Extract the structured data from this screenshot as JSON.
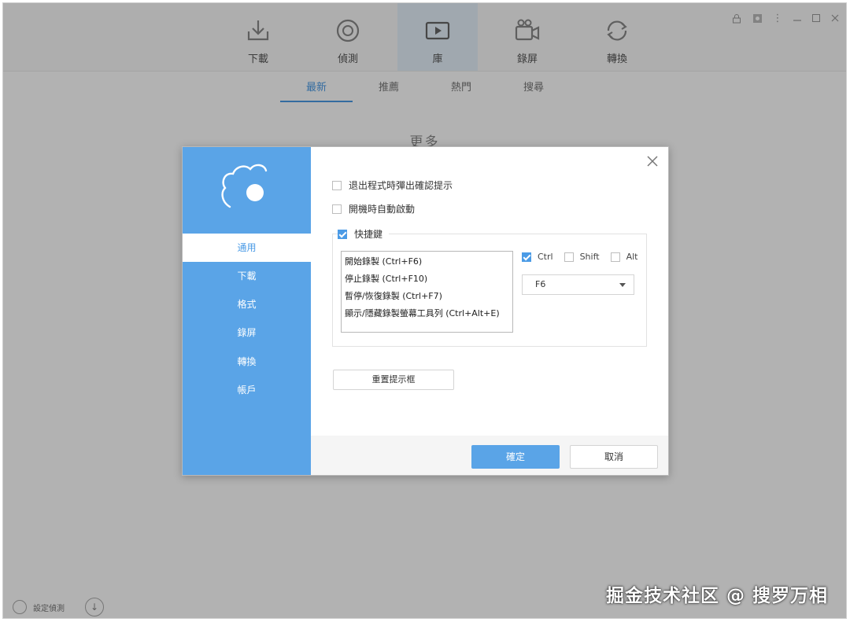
{
  "app": {
    "nav": [
      {
        "label": "下載",
        "icon": "download-icon",
        "active": false
      },
      {
        "label": "偵測",
        "icon": "detect-icon",
        "active": false
      },
      {
        "label": "庫",
        "icon": "library-icon",
        "active": true
      },
      {
        "label": "錄屏",
        "icon": "screen-record-icon",
        "active": false
      },
      {
        "label": "轉換",
        "icon": "convert-icon",
        "active": false
      }
    ],
    "subtabs": [
      "最新",
      "推薦",
      "熱門",
      "搜尋"
    ],
    "more_label": "更多",
    "status_text": "設定偵測"
  },
  "dialog": {
    "sidebar": [
      "通用",
      "下載",
      "格式",
      "錄屏",
      "轉換",
      "帳戶"
    ],
    "options": {
      "exit_confirm": {
        "label": "退出程式時彈出確認提示",
        "checked": false
      },
      "autostart": {
        "label": "開機時自動啟動",
        "checked": false
      },
      "hotkey": {
        "label": "快捷鍵",
        "checked": true
      }
    },
    "hotkeys": [
      "開始錄製 (Ctrl+F6)",
      "停止錄製 (Ctrl+F10)",
      "暫停/恢復錄製 (Ctrl+F7)",
      "顯示/隱藏錄製螢幕工具列 (Ctrl+Alt+E)"
    ],
    "modifiers": {
      "ctrl": {
        "label": "Ctrl",
        "checked": true
      },
      "shift": {
        "label": "Shift",
        "checked": false
      },
      "alt": {
        "label": "Alt",
        "checked": false
      }
    },
    "key_value": "F6",
    "reset_label": "重置提示框",
    "ok_label": "確定",
    "cancel_label": "取消"
  },
  "watermark": "掘金技术社区 @ 搜罗万相",
  "colors": {
    "accent": "#5aa4e7",
    "overlay": "rgba(0,0,0,0.30)"
  }
}
